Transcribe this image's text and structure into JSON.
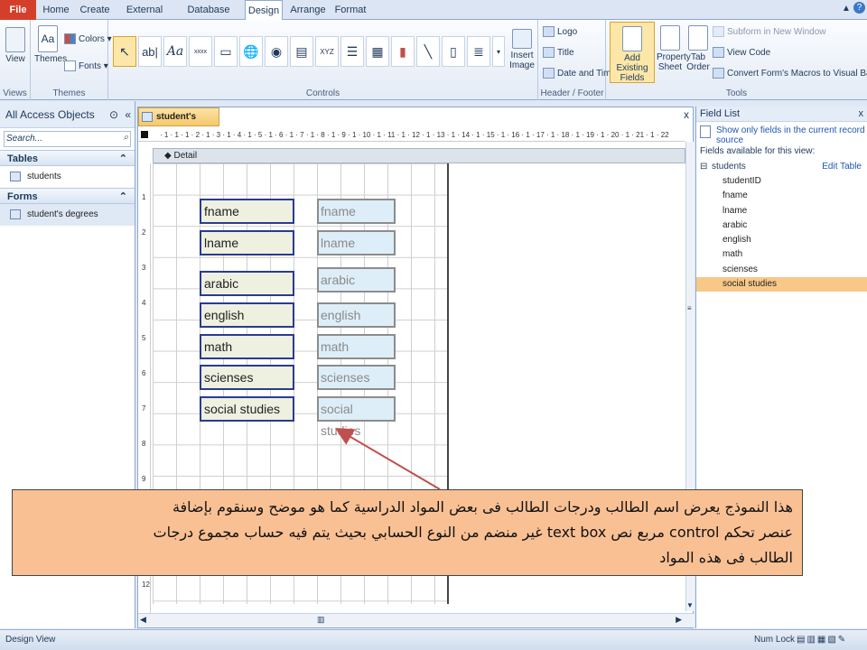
{
  "tabs": [
    "File",
    "Home",
    "Create",
    "External Data",
    "Database Tools",
    "Design",
    "Arrange",
    "Format"
  ],
  "ribbon": {
    "views": {
      "view_label": "View",
      "group": "Views"
    },
    "themes": {
      "themes_label": "Themes",
      "colors_label": "Colors",
      "fonts_label": "Fonts",
      "group": "Themes"
    },
    "controls": {
      "group": "Controls",
      "insert_image": "Insert Image"
    },
    "header_footer": {
      "logo": "Logo",
      "title": "Title",
      "date_time": "Date and Time",
      "group": "Header / Footer"
    },
    "tools": {
      "add_existing_fields": "Add Existing Fields",
      "property_sheet": "Property Sheet",
      "tab_order": "Tab Order",
      "subform": "Subform in New Window",
      "view_code": "View Code",
      "convert_macros": "Convert Form's Macros to Visual Basic",
      "group": "Tools"
    }
  },
  "nav": {
    "header": "All Access Objects",
    "search_placeholder": "Search...",
    "sections": [
      {
        "title": "Tables",
        "items": [
          "students"
        ]
      },
      {
        "title": "Forms",
        "items": [
          "student's degrees"
        ]
      }
    ]
  },
  "document": {
    "tab_title": "student's degrees",
    "section": "Detail",
    "ruler": "· 1 · 1 · 1 · 2 · 1 · 3 · 1 · 4 · 1 · 5 · 1 · 6 · 1 · 7 · 1 · 8 · 1 · 9 · 1 · 10 · 1 · 11 · 1 · 12 · 1 · 13 · 1 · 14 · 1 · 15 · 1 · 16 · 1 · 17 · 1 · 18 · 1 · 19 · 1 · 20 · 1 · 21 · 1 · 22",
    "labels": [
      "fname",
      "lname",
      "arabic",
      "english",
      "math",
      "scienses",
      "social studies"
    ],
    "textboxes": [
      "fname",
      "lname",
      "arabic",
      "english",
      "math",
      "scienses",
      "social studies"
    ],
    "vruler": [
      "1",
      "2",
      "3",
      "4",
      "5",
      "6",
      "7",
      "8",
      "9",
      "12"
    ]
  },
  "field_list": {
    "title": "Field List",
    "show_only": "Show only fields in the current record source",
    "available": "Fields available for this view:",
    "table": "students",
    "edit_table": "Edit Table",
    "fields": [
      "studentID",
      "fname",
      "lname",
      "arabic",
      "english",
      "math",
      "scienses",
      "social studies"
    ],
    "selected": "social studies"
  },
  "status": {
    "left": "Design View",
    "num_lock": "Num Lock"
  },
  "callout": {
    "line1": "هذا النموذج يعرض اسم الطالب ودرجات الطالب فى بعض المواد الدراسية كما هو موضح وسنقوم بإضافة",
    "line2": "عنصر تحكم control مربع نص text box غير منضم من النوع الحسابي بحيث يتم فيه حساب مجموع درجات",
    "line3": "الطالب فى هذه المواد"
  },
  "colors": {
    "file_tab": "#d43f2a",
    "selected_field": "#f8c888",
    "callout_bg": "#f9c094",
    "arrow": "#c0504d"
  }
}
